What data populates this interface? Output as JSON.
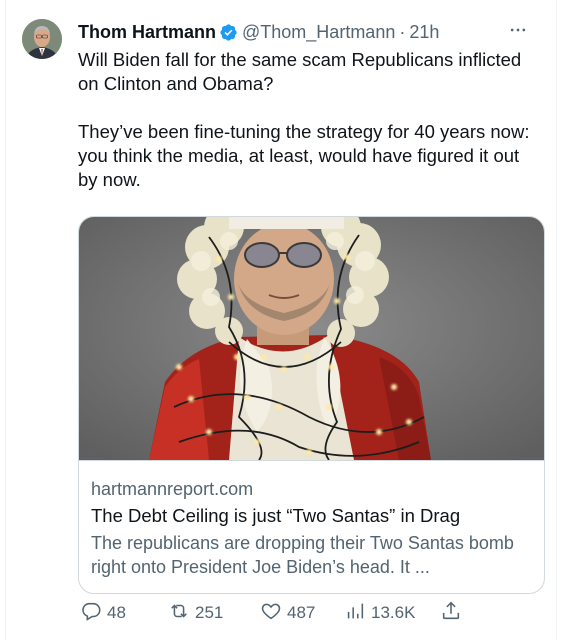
{
  "tweet": {
    "author": {
      "name": "Thom Hartmann",
      "handle": "@Thom_Hartmann",
      "separator": "·",
      "time": "21h"
    },
    "text": [
      "Will Biden fall for the same scam Republicans inflicted on Clinton and Obama?",
      "They’ve been fine-tuning the strategy for 40 years now: you think the media, at least, would have figured it out by now."
    ],
    "card": {
      "domain": "hartmannreport.com",
      "title": "The Debt Ceiling is just “Two Santas” in Drag",
      "description": "The republicans are dropping their Two Santas bomb right onto President Joe Biden’s head. It ..."
    },
    "actions": {
      "replies": "48",
      "reposts": "251",
      "likes": "487",
      "views": "13.6K"
    },
    "icons": {
      "verified": "verified-badge-icon",
      "more": "more-icon",
      "reply": "reply-icon",
      "repost": "repost-icon",
      "like": "heart-icon",
      "views": "views-chart-icon",
      "share": "share-icon"
    },
    "colors": {
      "verified": "#1d9bf0",
      "text": "#0f1419",
      "secondary": "#536471",
      "border": "#cfd9de"
    }
  }
}
